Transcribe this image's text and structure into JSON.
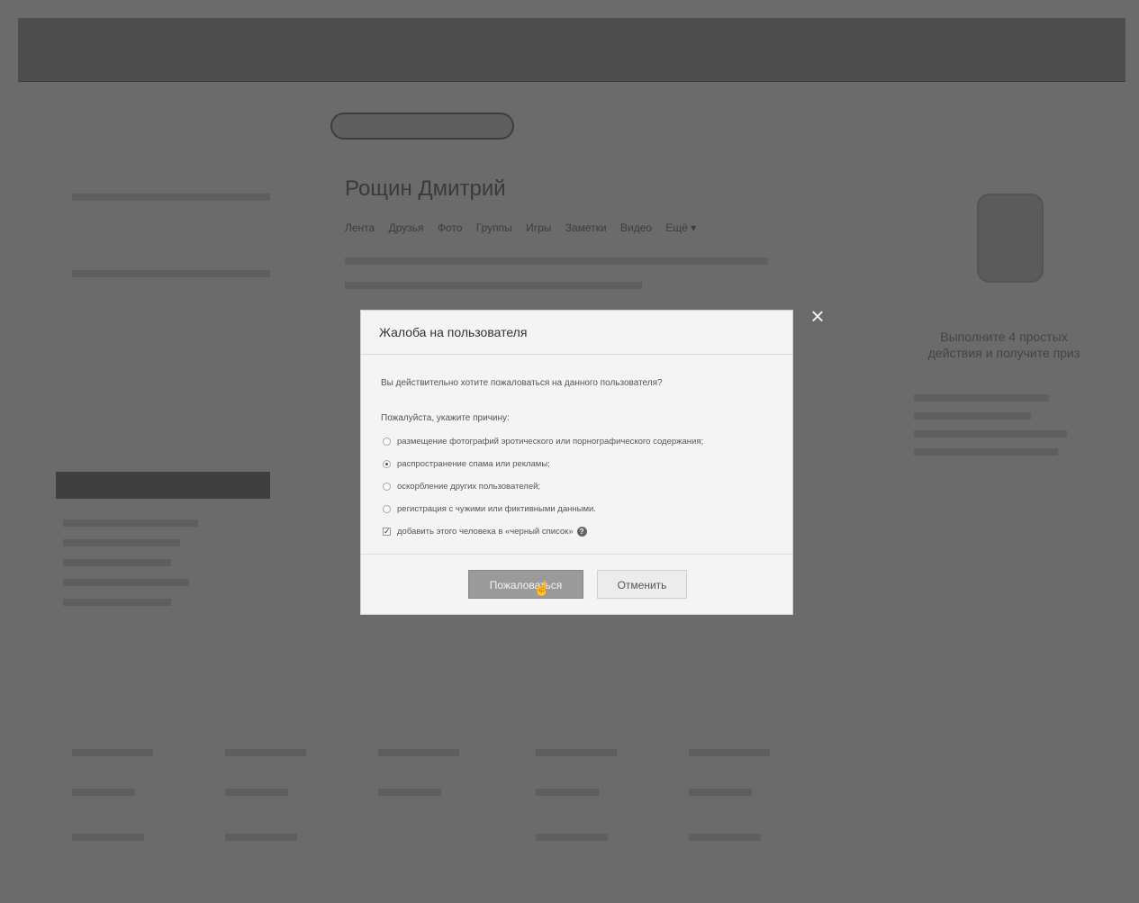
{
  "background": {
    "user_name": "Рощин Дмитрий",
    "profile_nav": [
      "Лента",
      "Друзья",
      "Фото",
      "Группы",
      "Игры",
      "Заметки",
      "Видео",
      "Ещё ▾"
    ],
    "right_title": "Выполните 4 простых действия и получите приз"
  },
  "modal": {
    "title": "Жалоба на пользователя",
    "close_icon": "close-icon",
    "question": "Вы действительно хотите пожаловаться на данного пользователя?",
    "reason_label": "Пожалуйста, укажите причину:",
    "reasons": [
      {
        "label": "размещение фотографий эротического или порнографического содержания;",
        "selected": false
      },
      {
        "label": "распространение спама или рекламы;",
        "selected": true
      },
      {
        "label": "оскорбление других пользователей;",
        "selected": false
      },
      {
        "label": "регистрация с чужими или фиктивными данными.",
        "selected": false
      }
    ],
    "blacklist_label": "добавить этого человека в «черный список»",
    "blacklist_checked": true,
    "submit_label": "Пожаловаться",
    "cancel_label": "Отменить"
  },
  "colors": {
    "overlay": "#6b6b6b",
    "modal_bg": "#f4f4f4",
    "primary_button": "#9a9a9a"
  }
}
